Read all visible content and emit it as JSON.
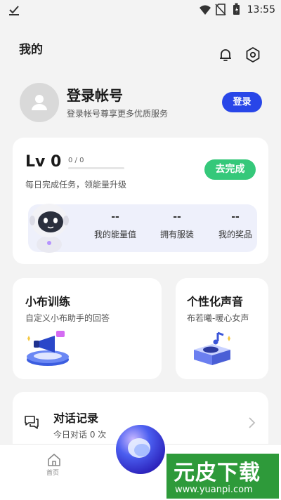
{
  "status_bar": {
    "time": "13:55"
  },
  "page_title": "我的",
  "login": {
    "title": "登录帐号",
    "subtitle": "登录帐号尊享更多优质服务",
    "button": "登录"
  },
  "level": {
    "label": "Lv 0",
    "progress_text": "0 / 0",
    "progress": 0,
    "subtitle": "每日完成任务，领能量升级",
    "action": "去完成",
    "stats": [
      {
        "value": "--",
        "label": "我的能量值"
      },
      {
        "value": "--",
        "label": "拥有服装"
      },
      {
        "value": "--",
        "label": "我的奖品"
      }
    ]
  },
  "training": {
    "title": "小布训练",
    "subtitle": "自定义小布助手的回答"
  },
  "voice": {
    "title": "个性化声音",
    "subtitle": "布若曦-暖心女声"
  },
  "history": {
    "title": "对话记录",
    "subtitle": "今日对话 0 次"
  },
  "nav": {
    "home": "首页"
  },
  "watermark": {
    "brand": "元皮下载",
    "url": "www.yuanpi.com"
  },
  "colors": {
    "accent": "#2846e8",
    "success": "#35c87a"
  }
}
